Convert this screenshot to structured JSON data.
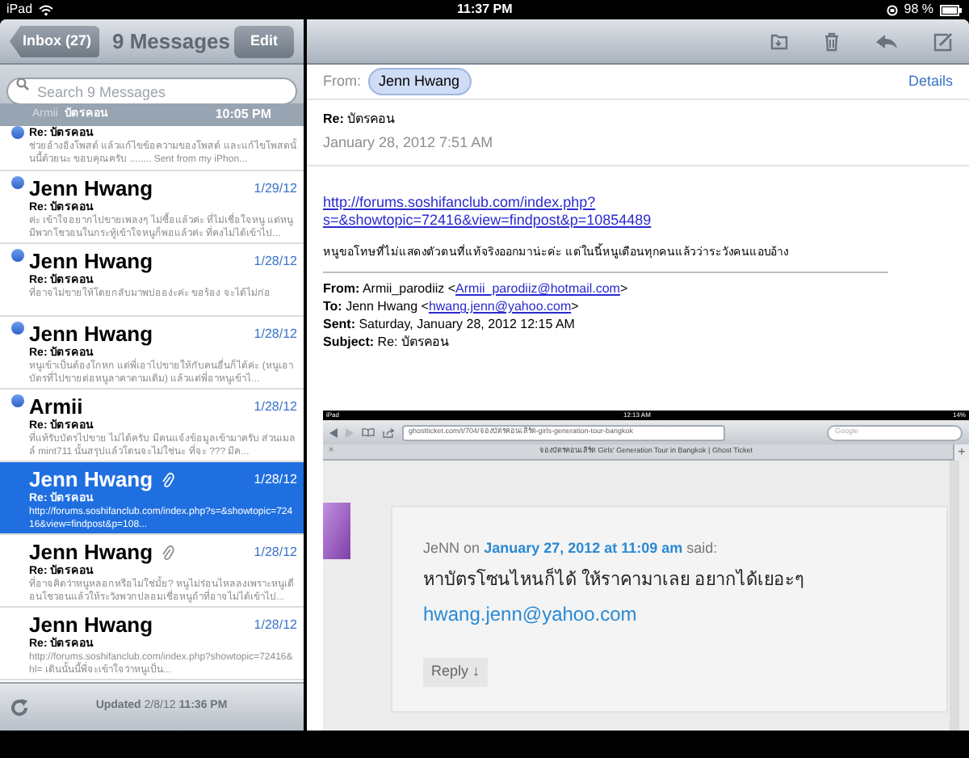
{
  "status_bar": {
    "device": "iPad",
    "time": "11:37 PM",
    "battery": "98 %"
  },
  "list_nav": {
    "back_button": "Inbox (27)",
    "title": "9 Messages",
    "edit_button": "Edit"
  },
  "search": {
    "placeholder": "Search 9 Messages"
  },
  "pinned_header": {
    "sender": "Armii",
    "subject": "บัตรคอน",
    "time": "10:05 PM"
  },
  "messages": [
    {
      "kind": "partial",
      "subject": "Re: บัตรคอน",
      "preview": "ช่วยอ้างอิงโพสต์ แล้วแก้ไขข้อความของโพสต์ และแก้ไขโพสตนั้นนี้ด้วยนะ ขอบคุณครับ ........ Sent from my iPhon...",
      "unread": true,
      "attachment": false,
      "selected": false
    },
    {
      "kind": "full",
      "sender": "Jenn Hwang",
      "date": "1/29/12",
      "subject": "Re: บัตรคอน",
      "preview": "ค่ะ เข้าใจอยากไปขายเพลงๆ ไม่ซื้อแล้วค่ะ ที่ไม่เชื่อใจหนู แต่หนูมีพวกโชวอนในกระทู้เข้าใจหนูก็พอแล้วค่ะ ที่คงไม่ได้เข้าไป...",
      "unread": true,
      "attachment": false,
      "selected": false
    },
    {
      "kind": "full",
      "sender": "Jenn Hwang",
      "date": "1/28/12",
      "subject": "Re: บัตรคอน",
      "preview": "ที่อาจไม่ขายให้โดยกลับมาพบ่ออง่ะค่ะ ขอร้อง จะได้ไม่ก่อ",
      "unread": true,
      "attachment": false,
      "selected": false
    },
    {
      "kind": "full",
      "sender": "Jenn Hwang",
      "date": "1/28/12",
      "subject": "Re: บัตรคอน",
      "preview": "หนูเข้าเป็นต้องโกหก แต่พี่เอาไปขายให้กับคนอื่นก็ได้ค่ะ (หนูเอาบัตรที่ไปขายต่อหนูลาคาตามเดิม) แล้วแต่พี่อาหนูเข้าไ...",
      "unread": true,
      "attachment": false,
      "selected": false
    },
    {
      "kind": "full",
      "sender": "Armii",
      "date": "1/28/12",
      "subject": "Re: บัตรคอน",
      "preview": "ที่แท้รับบัตรไปขาย ไม่ได้ครับ มีคนแจ้งข้อมูลเข้ามาครับ ส่วนเมลล์ mint711 นั้นสรุปแล้วโดนจะไม่ใช่นะ ที่จะ ??? มีค...",
      "unread": true,
      "attachment": false,
      "selected": false
    },
    {
      "kind": "full",
      "sender": "Jenn Hwang",
      "date": "1/28/12",
      "subject": "Re: บัตรคอน",
      "preview": "http://forums.soshifanclub.com/index.php?s=&showtopic=72416&view=findpost&p=108...",
      "unread": false,
      "attachment": true,
      "selected": true
    },
    {
      "kind": "full",
      "sender": "Jenn Hwang",
      "date": "1/28/12",
      "subject": "Re: บัตรคอน",
      "preview": "ที่อาจคิดว่าหนูหลอกหรือไม่ใช่มั้ย? หนูไม่ร่อนไหลลงเพราะหนูเดือนโชวอนแล้วให้ระวังพวกปลอมเชื่อหนูถ้าที่อาจไม่ได้เข้าไป...",
      "unread": false,
      "attachment": true,
      "selected": false
    },
    {
      "kind": "full",
      "sender": "Jenn Hwang",
      "date": "1/28/12",
      "subject": "Re: บัตรคอน",
      "preview": "http://forums.soshifanclub.com/index.php?showtopic=72416&hl= เดินนั้นนี้พี่จะเข้าใจว่าหนูเป็น...",
      "unread": false,
      "attachment": false,
      "selected": false
    }
  ],
  "list_toolbar": {
    "updated_label": "Updated",
    "updated_date": "2/8/12",
    "updated_time": "11:36 PM"
  },
  "message": {
    "from_label": "From:",
    "from": "Jenn Hwang",
    "details": "Details",
    "subject_label": "Re:",
    "subject": "บัตรคอน",
    "date": "January 28, 2012 7:51 AM",
    "link_lines": [
      "http://forums.soshifanclub.com/index.php?",
      "s=&showtopic=72416&view=findpost&p=10854489"
    ],
    "body": "หนูขอโทษที่ไม่แสดงตัวตนที่แท้จริงออกมาน่ะค่ะ แต่ในนี้หนูเตือนทุกคนแล้วว่าระวังคนแอบอ้าง",
    "quoted": [
      {
        "label": "From:",
        "text": "Armii_parodiiz <",
        "link": "Armii_parodiiz@hotmail.com",
        "after": ">"
      },
      {
        "label": "To:",
        "text": "Jenn Hwang <",
        "link": "hwang.jenn@yahoo.com",
        "after": ">"
      },
      {
        "label": "Sent:",
        "text": "Saturday, January 28, 2012 12:15 AM"
      },
      {
        "label": "Subject:",
        "text": "Re: บัตรคอน"
      }
    ],
    "embedded": {
      "device": "iPad",
      "time": "12:13 AM",
      "battery": "14%",
      "url": "ghostticket.com/t/704/จองบัตรคอนเสิร์ต-girls-generation-tour-bangkok",
      "search_placeholder": "Google",
      "tab_title": "จองบัตรคอนเสิร์ต Girls' Generation Tour in Bangkok | Ghost Ticket",
      "tab_close": "×",
      "tab_add": "+",
      "comment": {
        "author": "JeNN",
        "on": "on",
        "date_link": "January 27, 2012 at 11:09 am",
        "said": "said:",
        "text": "หาบัตรโซนไหนก็ได้ ให้ราคามาเลย อยากได้เยอะๆ",
        "email": "hwang.jenn@yahoo.com",
        "reply": "Reply ↓"
      }
    }
  }
}
